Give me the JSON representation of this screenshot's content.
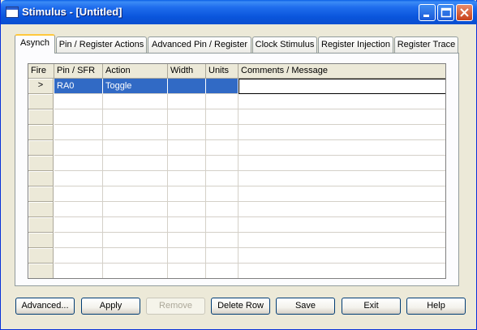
{
  "window": {
    "title": "Stimulus - [Untitled]"
  },
  "tabs": [
    {
      "label": "Asynch",
      "active": true
    },
    {
      "label": "Pin / Register Actions"
    },
    {
      "label": "Advanced Pin / Register"
    },
    {
      "label": "Clock Stimulus"
    },
    {
      "label": "Register Injection"
    },
    {
      "label": "Register Trace"
    }
  ],
  "grid": {
    "columns": [
      "Fire",
      "Pin / SFR",
      "Action",
      "Width",
      "Units",
      "Comments / Message"
    ],
    "rows": [
      {
        "fire": ">",
        "pin": "RA0",
        "action": "Toggle",
        "width": "",
        "units": "",
        "comments": ""
      }
    ]
  },
  "buttons": {
    "advanced": "Advanced...",
    "apply": "Apply",
    "remove": "Remove",
    "delete_row": "Delete Row",
    "save": "Save",
    "exit": "Exit",
    "help": "Help"
  },
  "colors": {
    "titlebar": "#0a55dc",
    "selection": "#316ac5",
    "tab_highlight": "#ffc83c"
  }
}
